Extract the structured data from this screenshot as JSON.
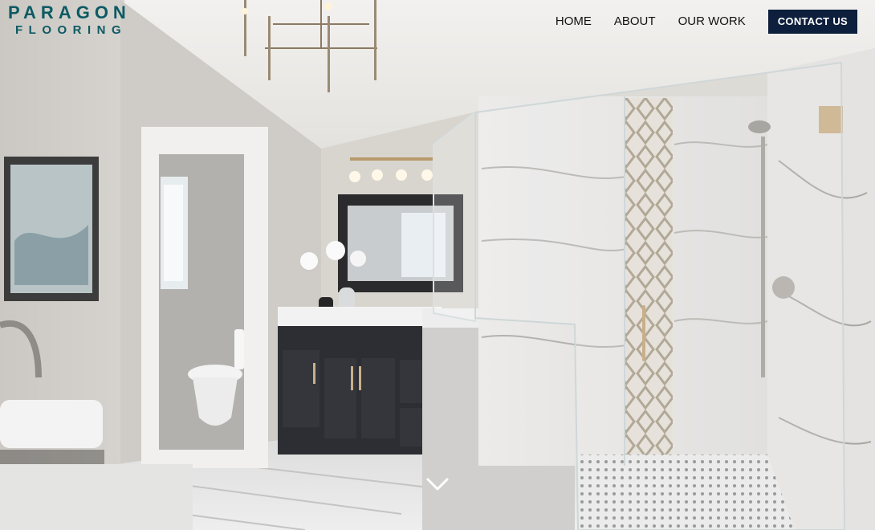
{
  "logo": {
    "line1": "PARAGON",
    "line2": "FLOORING"
  },
  "nav": {
    "items": [
      {
        "label": "HOME"
      },
      {
        "label": "ABOUT"
      },
      {
        "label": "OUR WORK"
      }
    ],
    "cta_label": "CONTACT US"
  },
  "hero": {
    "scroll_icon": "chevron-down-icon"
  },
  "colors": {
    "brand": "#0c5a63",
    "cta_bg": "#0e1f3d",
    "cta_text": "#ffffff"
  }
}
